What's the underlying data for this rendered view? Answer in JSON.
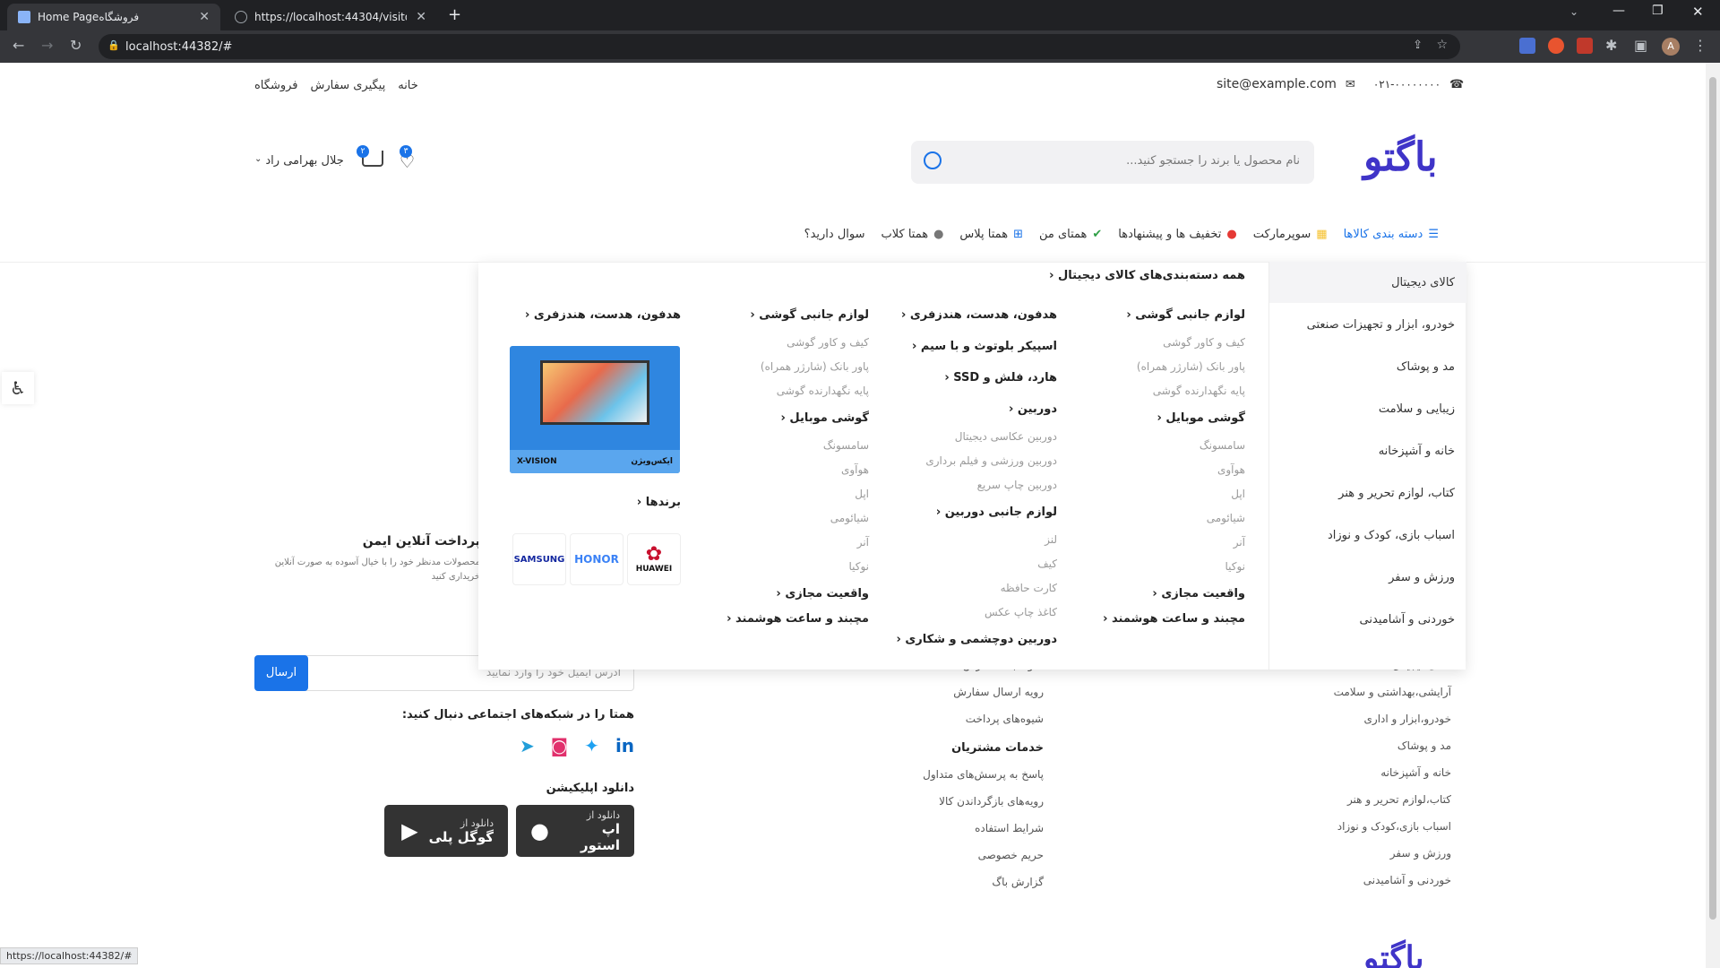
{
  "browser": {
    "tab1_title": "Home Pageفروشگاه",
    "tab2_title": "https://localhost:44304/visitor/in",
    "url": "localhost:44382/#",
    "status_url": "https://localhost:44382/#"
  },
  "topbar": {
    "links": [
      "خانه",
      "پیگیری سفارش",
      "فروشگاه"
    ],
    "email": "site@example.com",
    "phone": "۰۲۱-۰۰۰۰۰۰۰۰"
  },
  "header": {
    "logo": "باگتو",
    "search_placeholder": "نام محصول یا برند را جستجو کنید...",
    "user_name": "جلال بهرامی راد",
    "cart_count": "۲",
    "wishlist_count": "۳"
  },
  "nav": {
    "items": [
      "دسته بندی کالاها",
      "سوپرمارکت",
      "تخفیف ها و پیشنهادها",
      "همتای من",
      "همتا پلاس",
      "همتا کلاب",
      "سوال دارید؟"
    ]
  },
  "categories": [
    "کالای دیجیتال",
    "خودرو، ابزار و تجهیزات صنعتی",
    "مد و پوشاک",
    "زیبایی و سلامت",
    "خانه و آشپزخانه",
    "کتاب، لوازم تحریر و هنر",
    "اسباب بازی، کودک و نوزاد",
    "ورزش و سفر",
    "خوردنی و آشامیدنی"
  ],
  "megamenu": {
    "all_link": "همه دسته‌بندی‌های کالای دیجیتال",
    "col1": [
      {
        "h": "لوازم جانبی گوشی",
        "subs": [
          "کیف و کاور گوشی",
          "پاور بانک (شارژر همراه)",
          "پایه نگهدارنده گوشی"
        ]
      },
      {
        "h": "گوشی موبایل",
        "subs": [
          "سامسونگ",
          "هوآوی",
          "اپل",
          "شیائومی",
          "آنر",
          "نوکیا"
        ]
      },
      {
        "h": "واقعیت مجازی",
        "subs": []
      },
      {
        "h": "مچبند و ساعت هوشمند",
        "subs": []
      }
    ],
    "col2": [
      {
        "h": "هدفون، هدست، هندزفری",
        "subs": []
      },
      {
        "h": "اسپیکر بلوتوث و با سیم",
        "subs": []
      },
      {
        "h": "هارد، فلش و SSD",
        "subs": []
      },
      {
        "h": "دوربین",
        "subs": [
          "دوربین عکاسی دیجیتال",
          "دوربین ورزشی و فیلم برداری",
          "دوربین چاپ سریع"
        ]
      },
      {
        "h": "لوازم جانبی دوربین",
        "subs": [
          "لنز",
          "کیف",
          "کارت حافظه",
          "کاغذ چاپ عکس"
        ]
      },
      {
        "h": "دوربین دوچشمی و شکاری",
        "subs": []
      }
    ],
    "col3": [
      {
        "h": "لوازم جانبی گوشی",
        "subs": [
          "کیف و کاور گوشی",
          "پاور بانک (شارژر همراه)",
          "پایه نگهدارنده گوشی"
        ]
      },
      {
        "h": "گوشی موبایل",
        "subs": [
          "سامسونگ",
          "هوآوی",
          "اپل",
          "شیائومی",
          "آنر",
          "نوکیا"
        ]
      },
      {
        "h": "واقعیت مجازی",
        "subs": []
      },
      {
        "h": "مچبند و ساعت هوشمند",
        "subs": []
      }
    ],
    "col4_heading": "هدفون، هدست، هندزفری",
    "banner_brand_fa": "ایکس‌ویژن",
    "banner_brand_en": "X-VISION",
    "brands_heading": "برندها",
    "brands": [
      "SAMSUNG",
      "HONOR",
      "HUAWEI"
    ]
  },
  "footer": {
    "pay_title": "پرداخت آنلاین ایمن",
    "pay_text1": "محصولات مدنظر خود را با خیال آسوده به صورت آنلاین",
    "pay_text2": "خریداری کنید",
    "newsletter_placeholder": "آدرس ایمیل خود را وارد نمایید",
    "send": "ارسال",
    "social_title": "همتا را در شبکه‌های اجتماعی دنبال کنید:",
    "app_title": "دانلود اپلیکیشن",
    "appstore_small": "دانلود از",
    "appstore_big": "اپ استور",
    "gplay_small": "دانلود از",
    "gplay_big": "گوگل پلی",
    "col_guide": [
      "نحوه ثبت سفارش",
      "رویه ارسال سفارش",
      "شیوه‌های پرداخت"
    ],
    "service_title": "خدمات مشتریان",
    "col_service": [
      "پاسخ به پرسش‌های متداول",
      "رویه‌های بازگرداندن کالا",
      "شرایط استفاده",
      "حریم خصوصی",
      "گزارش باگ"
    ],
    "col_cats": [
      "کالای دیجیتال",
      "آرایشی،بهداشتی و سلامت",
      "خودرو،ابزار و اداری",
      "مد و پوشاک",
      "خانه و آشپزخانه",
      "کتاب،لوازم تحریر و هنر",
      "اسباب بازی،کودک و نوزاد",
      "ورزش و سفر",
      "خوردنی و آشامیدنی"
    ],
    "logo": "باگتو"
  },
  "colors": {
    "accent": "#1a73e8",
    "logo": "#3f34c8"
  }
}
